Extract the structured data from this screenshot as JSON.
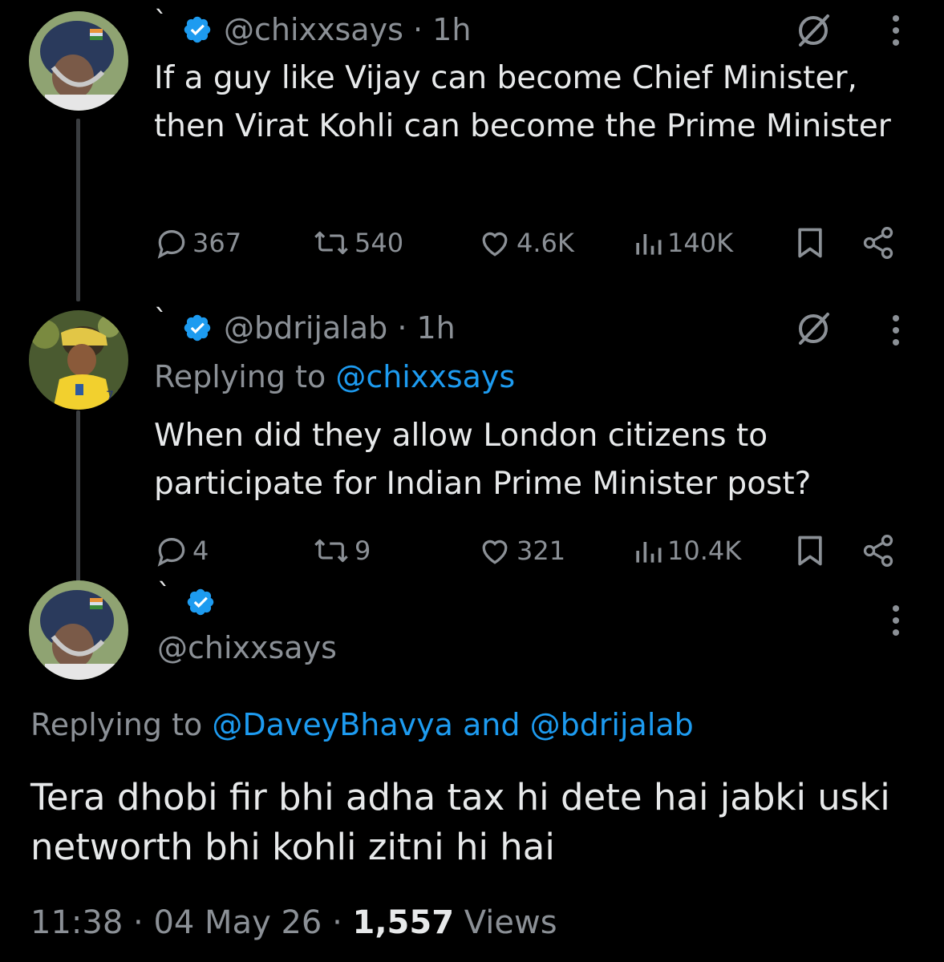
{
  "tweet1": {
    "tick": "`",
    "handle": "@chixxsays",
    "time": "1h",
    "text": "If a guy like Vijay can become Chief Minister, then Virat Kohli can become the Prime Minister",
    "replies": "367",
    "reposts": "540",
    "likes": "4.6K",
    "views": "140K"
  },
  "tweet2": {
    "tick": "`",
    "handle": "@bdrijalab",
    "time": "1h",
    "replying_prefix": "Replying to ",
    "replying_to": "@chixxsays",
    "text": "When did they allow London citizens to participate for Indian Prime Minister post?",
    "replies": "4",
    "reposts": "9",
    "likes": "321",
    "views": "10.4K"
  },
  "main_tweet": {
    "tick": "`",
    "handle": "@chixxsays",
    "replying_prefix": "Replying to ",
    "replying_to": "@DaveyBhavya and @bdrijalab",
    "text": "Tera dhobi fir bhi adha tax hi dete hai jabki uski networth bhi kohli zitni hi hai",
    "time": "11:38",
    "date": "04 May 26",
    "views_count": "1,557",
    "views_label": "Views"
  },
  "colors": {
    "background": "#000000",
    "text": "#e7e9ea",
    "muted": "#8b9096",
    "accent": "#1d9bf0"
  },
  "icons": [
    "verified-badge-icon",
    "grok-icon",
    "more-icon",
    "reply-icon",
    "repost-icon",
    "like-icon",
    "views-icon",
    "bookmark-icon",
    "share-icon"
  ]
}
